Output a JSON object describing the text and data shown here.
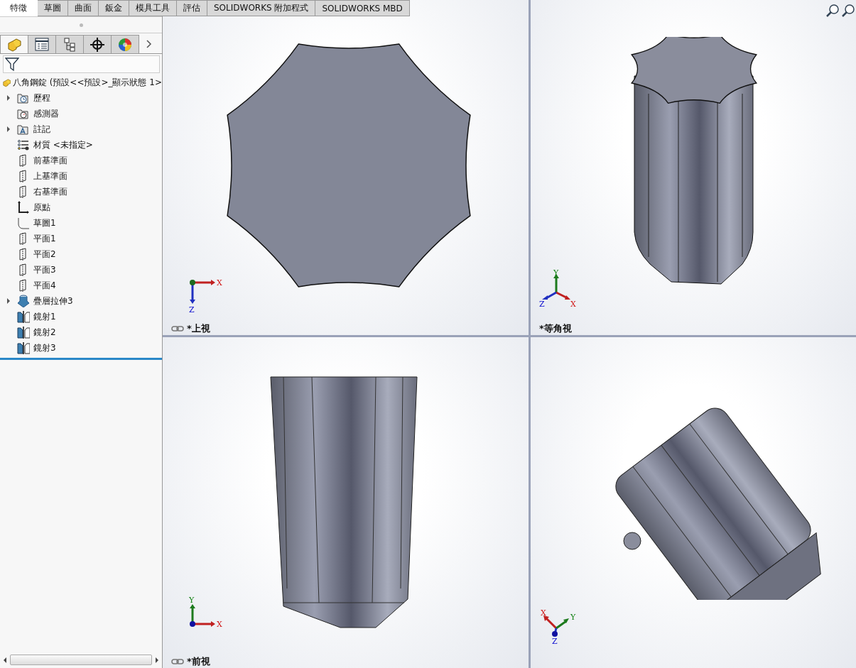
{
  "command_tabs": [
    {
      "label": "特徵",
      "selected": true
    },
    {
      "label": "草圖",
      "selected": false
    },
    {
      "label": "曲面",
      "selected": false
    },
    {
      "label": "鈑金",
      "selected": false
    },
    {
      "label": "模具工具",
      "selected": false
    },
    {
      "label": "評估",
      "selected": false
    },
    {
      "label": "SOLIDWORKS 附加程式",
      "selected": false
    },
    {
      "label": "SOLIDWORKS MBD",
      "selected": false
    }
  ],
  "panel_tabs": [
    {
      "kind": "feature",
      "selected": true
    },
    {
      "kind": "property",
      "selected": false
    },
    {
      "kind": "config",
      "selected": false
    },
    {
      "kind": "dimxpert",
      "selected": false
    },
    {
      "kind": "display",
      "selected": false
    }
  ],
  "tree": {
    "root": "八角鋼錠 (預設<<預設>_顯示狀態 1>",
    "items": [
      {
        "label": "歷程",
        "kind": "history",
        "expandable": true
      },
      {
        "label": "感測器",
        "kind": "sensor",
        "expandable": false
      },
      {
        "label": "註記",
        "kind": "annotation",
        "expandable": true
      },
      {
        "label": "材質 <未指定>",
        "kind": "material",
        "expandable": false
      },
      {
        "label": "前基準面",
        "kind": "plane",
        "expandable": false
      },
      {
        "label": "上基準面",
        "kind": "plane",
        "expandable": false
      },
      {
        "label": "右基準面",
        "kind": "plane",
        "expandable": false
      },
      {
        "label": "原點",
        "kind": "origin",
        "expandable": false
      },
      {
        "label": "草圖1",
        "kind": "sketch",
        "expandable": false
      },
      {
        "label": "平面1",
        "kind": "plane",
        "expandable": false
      },
      {
        "label": "平面2",
        "kind": "plane",
        "expandable": false
      },
      {
        "label": "平面3",
        "kind": "plane",
        "expandable": false
      },
      {
        "label": "平面4",
        "kind": "plane",
        "expandable": false
      },
      {
        "label": "疊層拉伸3",
        "kind": "loft",
        "expandable": true
      },
      {
        "label": "鏡射1",
        "kind": "mirror",
        "expandable": false
      },
      {
        "label": "鏡射2",
        "kind": "mirror",
        "expandable": false
      },
      {
        "label": "鏡射3",
        "kind": "mirror",
        "expandable": false
      }
    ]
  },
  "viewports": [
    {
      "kind": "top",
      "label": "*上視",
      "linked": true,
      "axes": [
        "X",
        "Z"
      ]
    },
    {
      "kind": "iso",
      "label": "*等角視",
      "linked": false,
      "axes": [
        "X",
        "Y",
        "Z"
      ]
    },
    {
      "kind": "front",
      "label": "*前視",
      "linked": true,
      "axes": [
        "X",
        "Y"
      ]
    },
    {
      "kind": "oblique",
      "axes": [
        "X",
        "Y",
        "Z"
      ]
    }
  ]
}
